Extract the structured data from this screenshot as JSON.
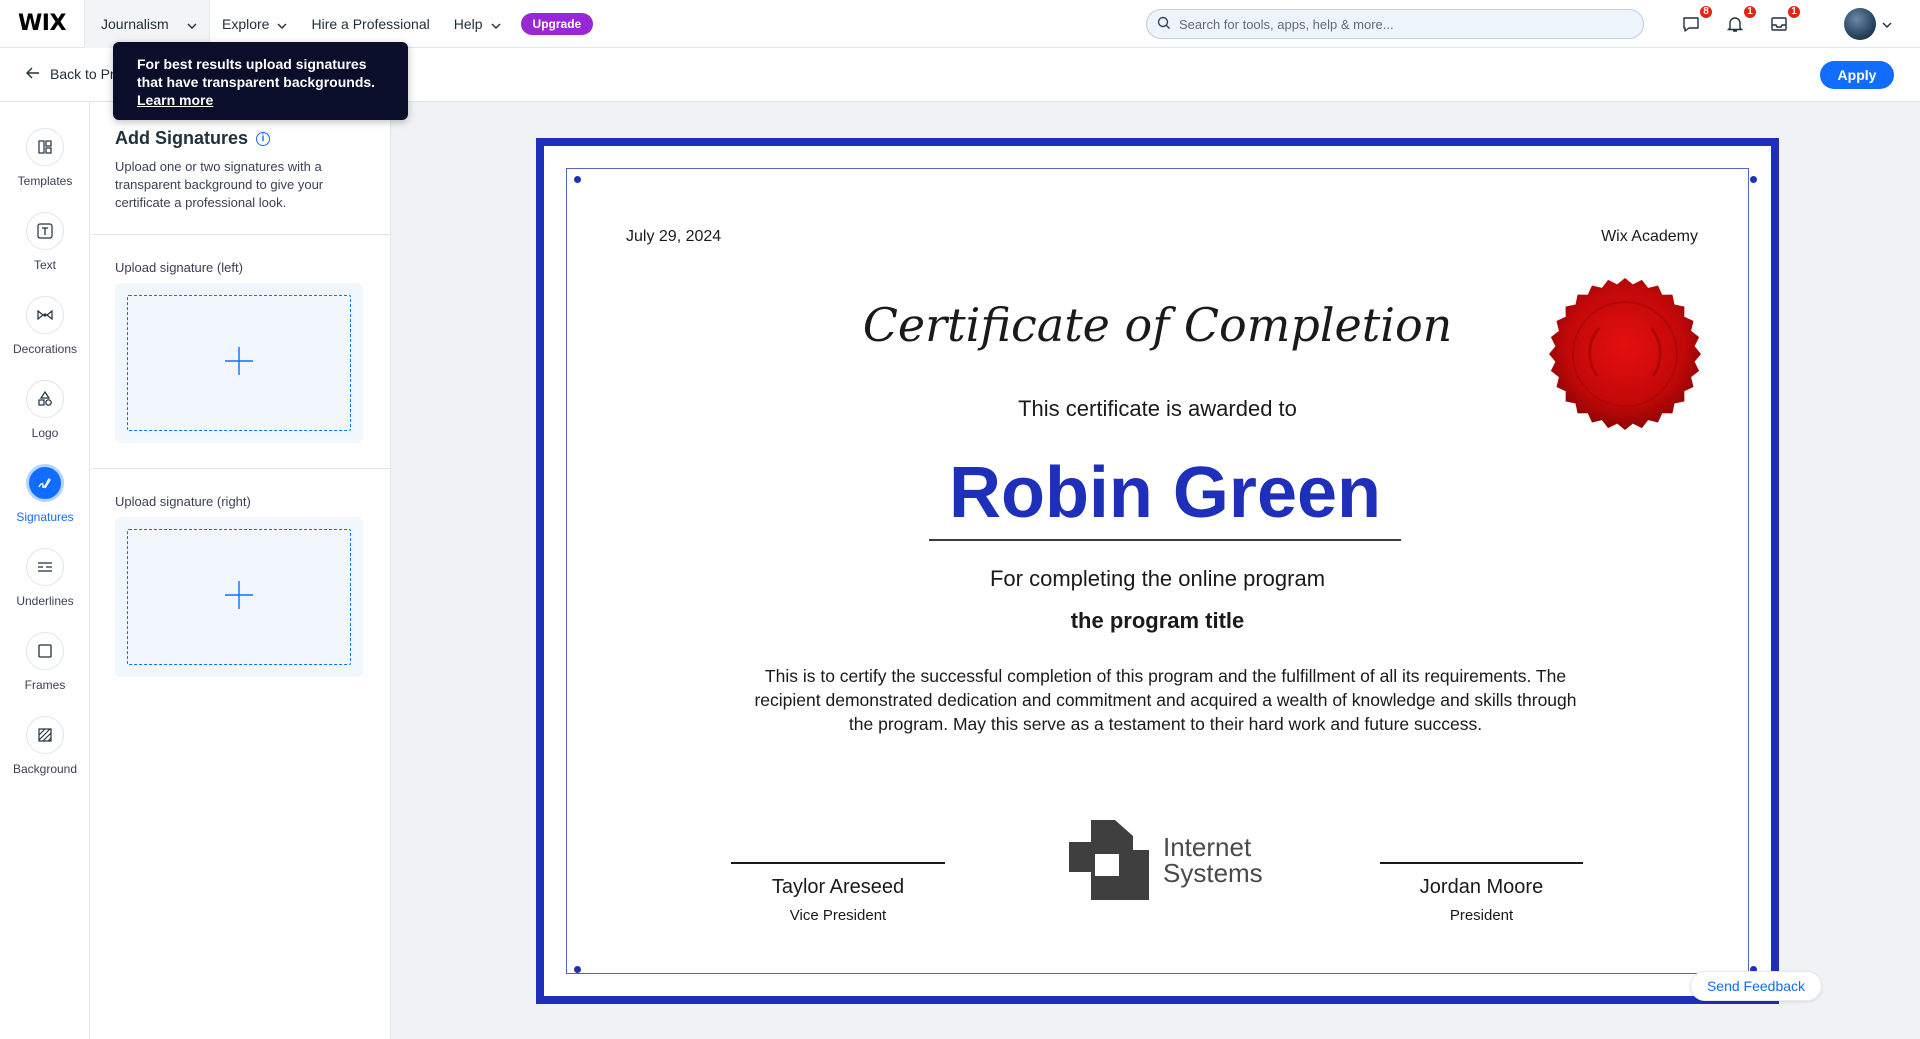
{
  "topbar": {
    "logo": "WIX",
    "site_name": "Journalism",
    "nav": [
      "Explore",
      "Hire a Professional",
      "Help"
    ],
    "upgrade": "Upgrade",
    "search_placeholder": "Search for tools, apps, help & more...",
    "badges": {
      "messages": "8",
      "notifications": "1",
      "inbox": "1"
    }
  },
  "subbar": {
    "back_label": "Back to Pr",
    "apply_label": "Apply"
  },
  "tooltip": {
    "line1": "For best results upload signatures",
    "line2": "that have transparent backgrounds.",
    "link": "Learn more"
  },
  "rail": {
    "items": [
      {
        "label": "Templates",
        "icon": "templates-icon"
      },
      {
        "label": "Text",
        "icon": "text-icon"
      },
      {
        "label": "Decorations",
        "icon": "decorations-icon"
      },
      {
        "label": "Logo",
        "icon": "logo-icon"
      },
      {
        "label": "Signatures",
        "icon": "signature-icon",
        "active": true
      },
      {
        "label": "Underlines",
        "icon": "underlines-icon"
      },
      {
        "label": "Frames",
        "icon": "frames-icon"
      },
      {
        "label": "Background",
        "icon": "background-icon"
      }
    ]
  },
  "panel": {
    "title": "Add Signatures",
    "description": "Upload one or two signatures with a transparent background to give your certificate a professional look.",
    "upload_left_label": "Upload signature (left)",
    "upload_right_label": "Upload signature (right)"
  },
  "certificate": {
    "date": "July 29, 2024",
    "organization": "Wix Academy",
    "title": "Certificate of Completion",
    "awarded_to": "This certificate is awarded to",
    "recipient": "Robin Green",
    "completing": "For completing the online program",
    "program": "the program title",
    "body": "This is to certify the successful completion of this program and the fulfillment of all its requirements. The recipient demonstrated dedication and commitment and acquired a wealth of knowledge and skills through the program. May this serve as a testament to their hard work and future success.",
    "logo_line1": "Internet",
    "logo_line2": "Systems",
    "signer_left_name": "Taylor Areseed",
    "signer_left_role": "Vice President",
    "signer_right_name": "Jordan Moore",
    "signer_right_role": "President",
    "border_color": "#1e2fb9",
    "seal_color": "#cc0a0a"
  },
  "feedback_label": "Send Feedback",
  "colors": {
    "accent": "#116dff",
    "upgrade": "#9a27d5",
    "badge": "#e62214"
  }
}
